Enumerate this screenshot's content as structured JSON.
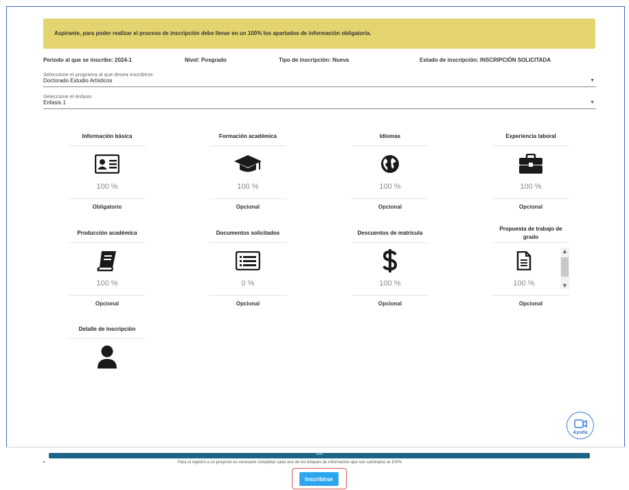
{
  "notice": "Aspirante, para poder realizar el proceso de inscripción debe llenar en un 100% los apartados de información obligatoria.",
  "info": {
    "periodo": "Periodo al que se inscribe: 2024-1",
    "nivel": "Nivel: Posgrado",
    "tipo": "Tipo de inscripción: Nueva",
    "estado": "Estado de inscripción: INSCRIPCIÓN SOLICITADA"
  },
  "programa": {
    "label": "Seleccione el programa al que desea inscribirse",
    "value": "Doctorado Estudio Artísticos"
  },
  "enfasis": {
    "label": "Seleccione el énfasis",
    "value": "Enfasis 1"
  },
  "cards": [
    {
      "title": "Información básica",
      "icon": "id-card-icon",
      "percent": "100 %",
      "req": "Obligatorio"
    },
    {
      "title": "Formación académica",
      "icon": "graduation-cap-icon",
      "percent": "100 %",
      "req": "Opcional"
    },
    {
      "title": "Idiomas",
      "icon": "globe-icon",
      "percent": "100 %",
      "req": "Opcional"
    },
    {
      "title": "Experiencia laboral",
      "icon": "briefcase-icon",
      "percent": "100 %",
      "req": "Opcional"
    },
    {
      "title": "Producción académica",
      "icon": "book-icon",
      "percent": "100 %",
      "req": "Opcional"
    },
    {
      "title": "Documentos solicitados",
      "icon": "list-icon",
      "percent": "0 %",
      "req": "Opcional"
    },
    {
      "title": "Descuentos de matrícula",
      "icon": "dollar-icon",
      "percent": "100 %",
      "req": "Opcional"
    },
    {
      "title": "Propuesta de trabajo de grado",
      "icon": "document-icon",
      "percent": "100 %",
      "req": "Opcional"
    },
    {
      "title": "Detalle de inscripción",
      "icon": "user-icon"
    }
  ],
  "help": {
    "label": "Ayuda"
  },
  "progress": {
    "text": "100%",
    "value": 1.0,
    "color": "#1c6586"
  },
  "footer_note": "Para el registro a un proyecto es necesario completar cada uno de los bloques de información que son solicitados al 100%",
  "submit": {
    "label": "Inscribirse",
    "color": "#2ba6ef"
  },
  "colors": {
    "notice_bg": "#e3d46f",
    "accent": "#3a7bd5"
  }
}
